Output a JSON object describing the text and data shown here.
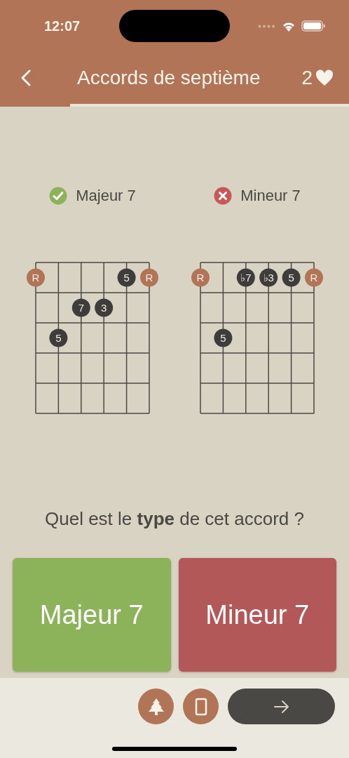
{
  "status_bar": {
    "time": "12:07"
  },
  "header": {
    "title": "Accords de septième",
    "lives": "2",
    "progress": {
      "level": 0.2
    }
  },
  "diagrams": [
    {
      "name": "Majeur 7",
      "correct": true,
      "frets": [
        [
          {
            "label": "R",
            "kind": "root"
          },
          {
            "kind": "empty"
          },
          {
            "kind": "empty"
          },
          {
            "kind": "empty"
          },
          {
            "label": "5",
            "kind": "note"
          },
          {
            "label": "R",
            "kind": "root"
          }
        ],
        [
          {
            "kind": "empty"
          },
          {
            "kind": "empty"
          },
          {
            "label": "7",
            "kind": "note"
          },
          {
            "label": "3",
            "kind": "note"
          },
          {
            "kind": "empty"
          },
          {
            "kind": "empty"
          }
        ],
        [
          {
            "kind": "empty"
          },
          {
            "label": "5",
            "kind": "note"
          },
          {
            "kind": "empty"
          },
          {
            "kind": "empty"
          },
          {
            "kind": "empty"
          },
          {
            "kind": "empty"
          }
        ],
        [
          {
            "kind": "empty"
          },
          {
            "kind": "empty"
          },
          {
            "kind": "empty"
          },
          {
            "kind": "empty"
          },
          {
            "kind": "empty"
          },
          {
            "kind": "empty"
          }
        ],
        [
          {
            "kind": "empty"
          },
          {
            "kind": "empty"
          },
          {
            "kind": "empty"
          },
          {
            "kind": "empty"
          },
          {
            "kind": "empty"
          },
          {
            "kind": "empty"
          }
        ]
      ]
    },
    {
      "name": "Mineur 7",
      "correct": false,
      "frets": [
        [
          {
            "label": "R",
            "kind": "root"
          },
          {
            "kind": "empty"
          },
          {
            "label": "♭7",
            "kind": "note"
          },
          {
            "label": "♭3",
            "kind": "note"
          },
          {
            "label": "5",
            "kind": "note"
          },
          {
            "label": "R",
            "kind": "root"
          }
        ],
        [
          {
            "kind": "empty"
          },
          {
            "kind": "empty"
          },
          {
            "kind": "empty"
          },
          {
            "kind": "empty"
          },
          {
            "kind": "empty"
          },
          {
            "kind": "empty"
          }
        ],
        [
          {
            "kind": "empty"
          },
          {
            "label": "5",
            "kind": "note"
          },
          {
            "kind": "empty"
          },
          {
            "kind": "empty"
          },
          {
            "kind": "empty"
          },
          {
            "kind": "empty"
          }
        ],
        [
          {
            "kind": "empty"
          },
          {
            "kind": "empty"
          },
          {
            "kind": "empty"
          },
          {
            "kind": "empty"
          },
          {
            "kind": "empty"
          },
          {
            "kind": "empty"
          }
        ],
        [
          {
            "kind": "empty"
          },
          {
            "kind": "empty"
          },
          {
            "kind": "empty"
          },
          {
            "kind": "empty"
          },
          {
            "kind": "empty"
          },
          {
            "kind": "empty"
          }
        ]
      ]
    }
  ],
  "question": "Quel est le **type** de cet accord ?",
  "answers": [
    {
      "label": "Majeur 7",
      "color": "#8db35a"
    },
    {
      "label": "Mineur 7",
      "color": "#b35858"
    }
  ]
}
